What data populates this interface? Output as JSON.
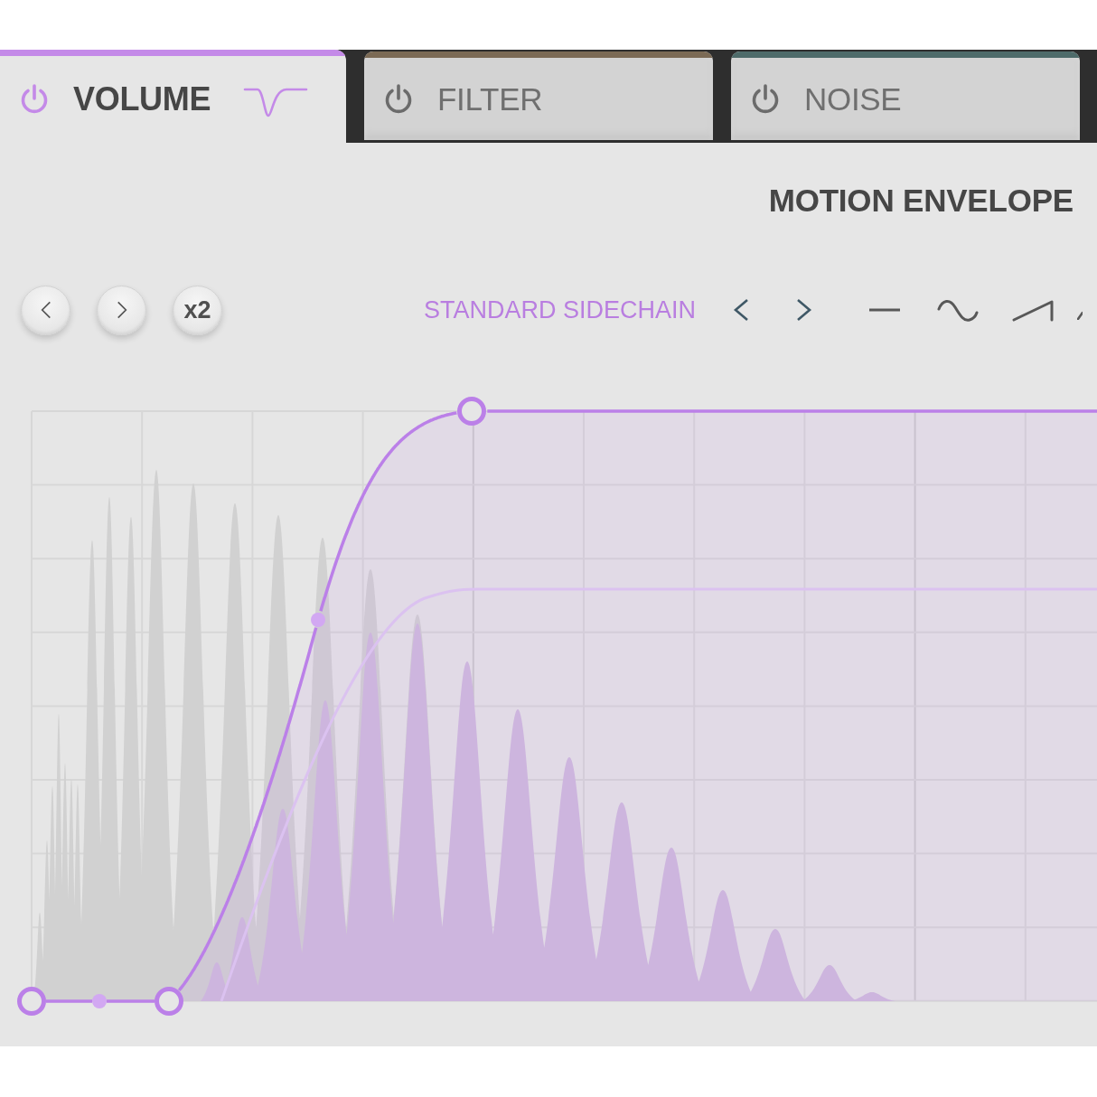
{
  "tabs": [
    {
      "label": "VOLUME",
      "selected": true,
      "on": true,
      "color": "#c48ae8"
    },
    {
      "label": "FILTER",
      "selected": false,
      "on": false,
      "color": "#7b6a55"
    },
    {
      "label": "NOISE",
      "selected": false,
      "on": false,
      "color": "#4e6b6a"
    }
  ],
  "panel": {
    "title": "MOTION ENVELOPE",
    "toolbar": {
      "multiplier_button": "x2",
      "preset_name": "STANDARD SIDECHAIN"
    }
  }
}
